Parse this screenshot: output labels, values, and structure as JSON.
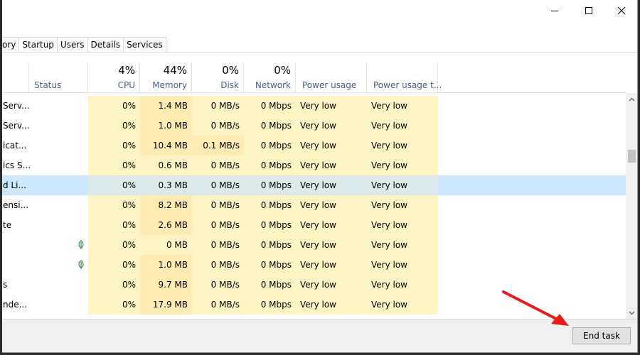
{
  "window": {
    "caption": {
      "minimize_glyph": "",
      "maximize_glyph": "",
      "close_glyph": "✕"
    }
  },
  "tabs": [
    {
      "label": "ory"
    },
    {
      "label": "Startup"
    },
    {
      "label": "Users"
    },
    {
      "label": "Details"
    },
    {
      "label": "Services"
    }
  ],
  "columns": {
    "status": {
      "label": "Status"
    },
    "cpu": {
      "percent": "4%",
      "label": "CPU"
    },
    "memory": {
      "percent": "44%",
      "label": "Memory"
    },
    "disk": {
      "percent": "0%",
      "label": "Disk"
    },
    "network": {
      "percent": "0%",
      "label": "Network"
    },
    "power": {
      "label": "Power usage"
    },
    "power_trend": {
      "label": "Power usage t..."
    }
  },
  "rows": [
    {
      "name": "Serv...",
      "cpu": "0%",
      "memory": "1.4 MB",
      "disk": "0 MB/s",
      "network": "0 Mbps",
      "power": "Very low",
      "power_trend": "Very low"
    },
    {
      "name": "Serv...",
      "cpu": "0%",
      "memory": "1.0 MB",
      "disk": "0 MB/s",
      "network": "0 Mbps",
      "power": "Very low",
      "power_trend": "Very low"
    },
    {
      "name": "icat...",
      "cpu": "0%",
      "memory": "10.4 MB",
      "disk": "0.1 MB/s",
      "network": "0 Mbps",
      "power": "Very low",
      "power_trend": "Very low"
    },
    {
      "name": "ics S...",
      "cpu": "0%",
      "memory": "0.6 MB",
      "disk": "0 MB/s",
      "network": "0 Mbps",
      "power": "Very low",
      "power_trend": "Very low"
    },
    {
      "name": "d Li...",
      "cpu": "0%",
      "memory": "0.3 MB",
      "disk": "0 MB/s",
      "network": "0 Mbps",
      "power": "Very low",
      "power_trend": "Very low"
    },
    {
      "name": "ensi...",
      "cpu": "0%",
      "memory": "8.2 MB",
      "disk": "0 MB/s",
      "network": "0 Mbps",
      "power": "Very low",
      "power_trend": "Very low"
    },
    {
      "name": "te",
      "cpu": "0%",
      "memory": "2.6 MB",
      "disk": "0 MB/s",
      "network": "0 Mbps",
      "power": "Very low",
      "power_trend": "Very low"
    },
    {
      "name": "",
      "cpu": "0%",
      "memory": "0 MB",
      "disk": "0 MB/s",
      "network": "0 Mbps",
      "power": "Very low",
      "power_trend": "Very low"
    },
    {
      "name": "",
      "cpu": "0%",
      "memory": "1.0 MB",
      "disk": "0 MB/s",
      "network": "0 Mbps",
      "power": "Very low",
      "power_trend": "Very low"
    },
    {
      "name": "s",
      "cpu": "0%",
      "memory": "9.7 MB",
      "disk": "0 MB/s",
      "network": "0 Mbps",
      "power": "Very low",
      "power_trend": "Very low"
    },
    {
      "name": "nde...",
      "cpu": "0%",
      "memory": "17.9 MB",
      "disk": "0 MB/s",
      "network": "0 Mbps",
      "power": "Very low",
      "power_trend": "Very low"
    }
  ],
  "footer": {
    "end_task_label": "End task"
  },
  "colors": {
    "accent_arrow": "#e81c1c",
    "selection": "#cce8ff",
    "heat_light": "#fff4c4",
    "heat_medium": "#ffecb3",
    "header_text": "#4d6082",
    "leaf_icon": "#2e8b3a"
  },
  "icons": {
    "eco_status": "leaf-icon",
    "scroll_up": "chevron-up-icon",
    "scroll_down": "chevron-down-icon"
  }
}
